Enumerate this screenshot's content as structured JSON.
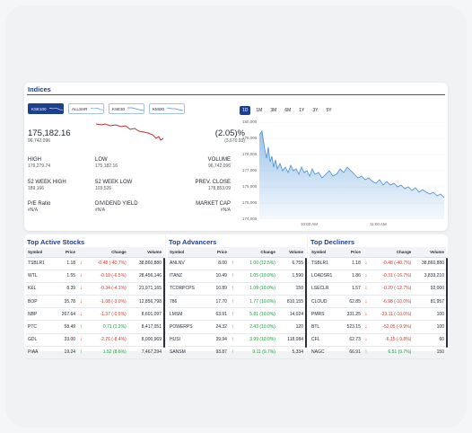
{
  "indices": {
    "title": "Indices",
    "tabs": [
      {
        "label": "KSE100",
        "active": true
      },
      {
        "label": "ALLSHR",
        "active": false
      },
      {
        "label": "KSE30",
        "active": false
      },
      {
        "label": "KMI30",
        "active": false
      }
    ],
    "current": "175,182.16",
    "previous_small": "96,742,096",
    "change": "(2.05)%",
    "change_small": "(3,670.93)",
    "stats": {
      "high_label": "HIGH",
      "high_value": "179,279.74",
      "low_label": "LOW",
      "low_value": "175,182.16",
      "volume_label": "VOLUME",
      "volume_value": "96,742,096",
      "wk52_high_label": "52 WEEK HIGH",
      "wk52_high_value": "189,166",
      "wk52_low_label": "52 WEEK LOW",
      "wk52_low_value": "103,526",
      "prev_close_label": "PREV. CLOSE",
      "prev_close_value": "178,853.09",
      "pe_label": "P/E Ratio",
      "pe_value": "#N/A",
      "div_label": "DIVIDEND YIELD",
      "div_value": "#N/A",
      "mcap_label": "MARKET CAP",
      "mcap_value": "#N/A"
    },
    "range_tabs": [
      "1D",
      "1M",
      "3M",
      "6M",
      "1Y",
      "3Y",
      "5Y"
    ],
    "active_range": "1D",
    "chart_data": {
      "type": "area",
      "y_ticks": [
        "180,000",
        "179,000",
        "178,000",
        "177,000",
        "176,000",
        "175,000",
        "174,000"
      ],
      "x_ticks": [
        "10:00 AM",
        "11:00 AM"
      ],
      "ylim": [
        174000,
        180000
      ],
      "accent": "#4a90d9"
    }
  },
  "colors": {
    "brand": "#1c3f8f",
    "negative": "#d9342b",
    "positive": "#1b9c3b"
  },
  "tables": [
    {
      "title": "Top Active Stocks",
      "headers": [
        "Symbol",
        "Price",
        "Change",
        "Volume"
      ],
      "rows": [
        {
          "symbol": "TSBLR1",
          "price": "1.18",
          "dir": "down",
          "change": "-0.48 (-40.7%)",
          "volume": "38,860,880"
        },
        {
          "symbol": "WTL",
          "price": "1.55",
          "dir": "down",
          "change": "-0.10 (-6.5%)",
          "volume": "28,456,146"
        },
        {
          "symbol": "KEL",
          "price": "8.39",
          "dir": "down",
          "change": "-0.34 (-4.1%)",
          "volume": "21,971,165"
        },
        {
          "symbol": "BOP",
          "price": "35.78",
          "dir": "down",
          "change": "-1.08 (-3.0%)",
          "volume": "12,856,798"
        },
        {
          "symbol": "NBP",
          "price": "267.64",
          "dir": "down",
          "change": "-1.37 (-0.5%)",
          "volume": "8,601,097"
        },
        {
          "symbol": "PTC",
          "price": "58.49",
          "dir": "up",
          "change": "0.71 (1.2%)",
          "volume": "8,417,051"
        },
        {
          "symbol": "GDL",
          "price": "33.00",
          "dir": "down",
          "change": "-2.76 (-8.4%)",
          "volume": "8,000,969"
        },
        {
          "symbol": "PIAA",
          "price": "19.24",
          "dir": "up",
          "change": "1.52 (8.6%)",
          "volume": "7,467,294"
        }
      ]
    },
    {
      "title": "Top Advancers",
      "headers": [
        "Symbol",
        "Price",
        "Change",
        "Volume"
      ],
      "rows": [
        {
          "symbol": "ANLNV",
          "price": "8.00",
          "dir": "up",
          "change": "1.00 (12.5%)",
          "volume": "6,755"
        },
        {
          "symbol": "ITANZ",
          "price": "10.49",
          "dir": "up",
          "change": "1.05 (10.0%)",
          "volume": "1,590"
        },
        {
          "symbol": "TCORPCPS",
          "price": "10.89",
          "dir": "up",
          "change": "1.09 (10.0%)",
          "volume": "150"
        },
        {
          "symbol": "786",
          "price": "17.70",
          "dir": "up",
          "change": "1.77 (10.0%)",
          "volume": "810,155"
        },
        {
          "symbol": "LMSM",
          "price": "63.91",
          "dir": "up",
          "change": "5.81 (10.0%)",
          "volume": "14,024"
        },
        {
          "symbol": "POWERPS",
          "price": "24.32",
          "dir": "up",
          "change": "2.43 (10.0%)",
          "volume": "120"
        },
        {
          "symbol": "HUSI",
          "price": "39.94",
          "dir": "up",
          "change": "3.99 (10.0%)",
          "volume": "118,084"
        },
        {
          "symbol": "SANSM",
          "price": "93.87",
          "dir": "up",
          "change": "9.11 (9.7%)",
          "volume": "5,334"
        }
      ]
    },
    {
      "title": "Top Decliners",
      "headers": [
        "Symbol",
        "Price",
        "Change",
        "Volume"
      ],
      "rows": [
        {
          "symbol": "TSBLR1",
          "price": "1.18",
          "dir": "down",
          "change": "-0.48 (-40.7%)",
          "volume": "38,860,880"
        },
        {
          "symbol": "LOADSR1",
          "price": "1.86",
          "dir": "down",
          "change": "-0.31 (-16.7%)",
          "volume": "3,833,210"
        },
        {
          "symbol": "LSECLR",
          "price": "1.57",
          "dir": "down",
          "change": "-0.20 (-12.7%)",
          "volume": "92,000"
        },
        {
          "symbol": "CLOUD",
          "price": "62.85",
          "dir": "down",
          "change": "-6.98 (-10.0%)",
          "volume": "81,957"
        },
        {
          "symbol": "PMRS",
          "price": "331.25",
          "dir": "down",
          "change": "-33.11 (-10.0%)",
          "volume": "100"
        },
        {
          "symbol": "BTL",
          "price": "523.15",
          "dir": "down",
          "change": "-52.05 (-9.9%)",
          "volume": "100"
        },
        {
          "symbol": "CFL",
          "price": "62.73",
          "dir": "down",
          "change": "-6.15 (-9.8%)",
          "volume": "60"
        },
        {
          "symbol": "NAGC",
          "price": "66.91",
          "dir": "up",
          "change": "6.51 (9.7%)",
          "volume": "150"
        }
      ]
    }
  ]
}
